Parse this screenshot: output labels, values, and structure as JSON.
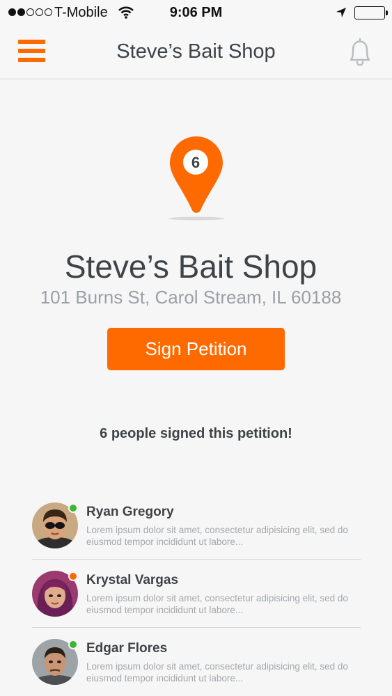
{
  "status_bar": {
    "carrier": "T-Mobile",
    "time": "9:06 PM",
    "signal_filled": 2,
    "signal_total": 5
  },
  "nav": {
    "title": "Steve’s Bait Shop",
    "menu_icon": "hamburger-menu-icon",
    "bell_icon": "bell-icon"
  },
  "shop": {
    "pin_number": "6",
    "name": "Steve’s Bait Shop",
    "address": "101 Burns St, Carol Stream, IL 60188"
  },
  "sign_button": {
    "label": "Sign Petition"
  },
  "signed_summary": "6 people signed this petition!",
  "colors": {
    "accent": "#ff6a00",
    "text_dark": "#3d4347",
    "text_muted": "#9aa0a5",
    "online": "#3cb52f",
    "away": "#ff6a00"
  },
  "signers": [
    {
      "name": "Ryan Gregory",
      "text": "Lorem ipsum dolor sit amet, consectetur adipisicing elit, sed do eiusmod tempor incididunt ut labore...",
      "status_color": "#3cb52f"
    },
    {
      "name": "Krystal Vargas",
      "text": "Lorem ipsum dolor sit amet, consectetur adipisicing elit, sed do eiusmod tempor incididunt ut labore...",
      "status_color": "#ff6a00"
    },
    {
      "name": "Edgar Flores",
      "text": "Lorem ipsum dolor sit amet, consectetur adipisicing elit, sed do eiusmod tempor incididunt ut labore...",
      "status_color": "#3cb52f"
    }
  ]
}
